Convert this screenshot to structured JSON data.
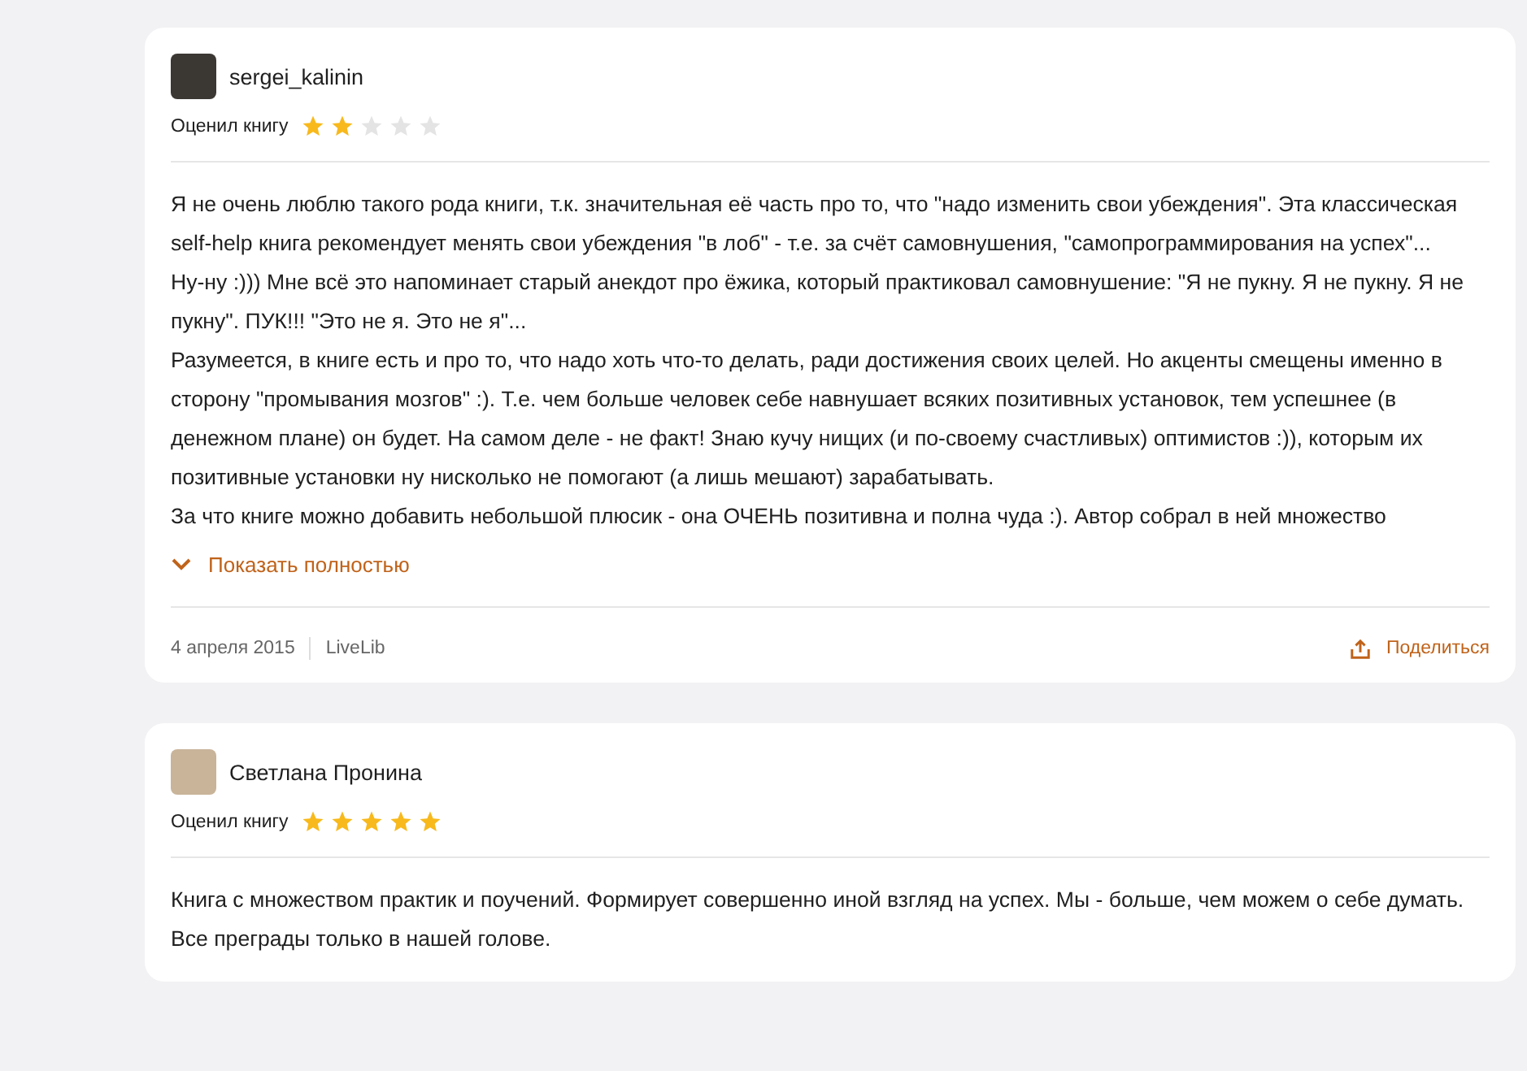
{
  "reviews": [
    {
      "author": "sergei_kalinin",
      "rating_label": "Оценил книгу",
      "stars": 2,
      "paragraphs": [
        "Я не очень люблю такого рода книги, т.к. значительная её часть про то, что \"надо изменить свои убеждения\". Эта классическая self-help книга рекомендует менять свои убеждения \"в лоб\" - т.е. за счёт самовнушения, \"самопрограммирования на успех\"...",
        "Ну-ну :))) Мне всё это напоминает старый анекдот про ёжика, который практиковал самовнушение: \"Я не пукну. Я не пукну. Я не пукну\". ПУК!!! \"Это не я. Это не я\"...",
        "Разумеется, в книге есть и про то, что надо хоть что-то делать, ради достижения своих целей. Но акценты смещены именно в сторону \"промывания мозгов\" :). Т.е. чем больше человек себе навнушает всяких позитивных установок, тем успешнее (в денежном плане) он будет. На самом деле - не факт! Знаю кучу нищих (и по-своему счастливых) оптимистов :)), которым их позитивные установки ну нисколько не помогают (а лишь мешают) зарабатывать.",
        "За что книге можно добавить небольшой плюсик - она ОЧЕНЬ позитивна и полна чуда :). Автор собрал в ней множество"
      ],
      "expand_label": "Показать полностью",
      "date": "4 апреля 2015",
      "source": "LiveLib",
      "share_label": "Поделиться"
    },
    {
      "author": "Светлана Пронина",
      "rating_label": "Оценил книгу",
      "stars": 5,
      "paragraphs": [
        "Книга с множеством практик и поучений. Формирует совершенно иной взгляд на успех. Мы - больше, чем можем о себе думать. Все преграды только в нашей голове."
      ]
    }
  ]
}
